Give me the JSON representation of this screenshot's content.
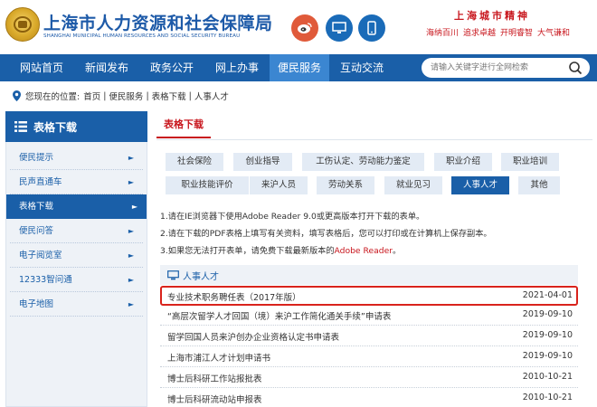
{
  "header": {
    "title": "上海市人力资源和社会保障局",
    "subtitle": "SHANGHAI MUNICIPAL HUMAN RESOURCES AND SOCIAL SECURITY BUREAU",
    "spirit_title": "上海城市精神",
    "spirit_items": [
      "海纳百川",
      "追求卓越",
      "开明睿智",
      "大气谦和"
    ],
    "icons": [
      "weibo-icon",
      "screen-icon",
      "mobile-icon"
    ]
  },
  "nav": {
    "items": [
      "网站首页",
      "新闻发布",
      "政务公开",
      "网上办事",
      "便民服务",
      "互动交流"
    ],
    "active_index": 4,
    "search_placeholder": "请输入关键字进行全网检索"
  },
  "breadcrumb": {
    "prefix": "您现在的位置:",
    "items": [
      "首页",
      "便民服务",
      "表格下载",
      "人事人才"
    ]
  },
  "sidebar": {
    "title": "表格下载",
    "items": [
      {
        "label": "便民提示"
      },
      {
        "label": "民声直通车"
      },
      {
        "label": "表格下载"
      },
      {
        "label": "便民问答"
      },
      {
        "label": "电子阅览室"
      },
      {
        "label": "12333智问通"
      },
      {
        "label": "电子地图"
      }
    ],
    "active_index": 2
  },
  "main": {
    "tab": "表格下载",
    "categories": [
      "社会保险",
      "创业指导",
      "工伤认定、劳动能力鉴定",
      "职业介绍",
      "职业培训",
      "职业技能评价",
      "来沪人员",
      "劳动关系",
      "就业见习",
      "人事人才",
      "其他"
    ],
    "active_category": "人事人才",
    "notes": [
      "1.请在IE浏览器下使用Adobe Reader 9.0或更高版本打开下载的表单。",
      "2.请在下载的PDF表格上填写有关资料，填写表格后，您可以打印或在计算机上保存副本。",
      "3.如果您无法打开表单，请免费下载最新版本的"
    ],
    "notes_link": "Adobe Reader",
    "notes_end": "。",
    "section_title": "人事人才",
    "rows": [
      {
        "title": "专业技术职务聘任表（2017年版）",
        "date": "2021-04-01"
      },
      {
        "title": "“高层次留学人才回国（境）来沪工作简化通关手续”申请表",
        "date": "2019-09-10"
      },
      {
        "title": "留学回国人员来沪创办企业资格认定书申请表",
        "date": "2019-09-10"
      },
      {
        "title": "上海市浦江人才计划申请书",
        "date": "2019-09-10"
      },
      {
        "title": "博士后科研工作站报批表",
        "date": "2010-10-21"
      },
      {
        "title": "博士后科研流动站申报表",
        "date": "2010-10-21"
      }
    ],
    "highlight_index": 0
  },
  "colors": {
    "brand_blue": "#1a5fa8",
    "nav_active": "#3b86d1",
    "accent_red": "#c8161d",
    "highlight_border": "#d9231c"
  }
}
